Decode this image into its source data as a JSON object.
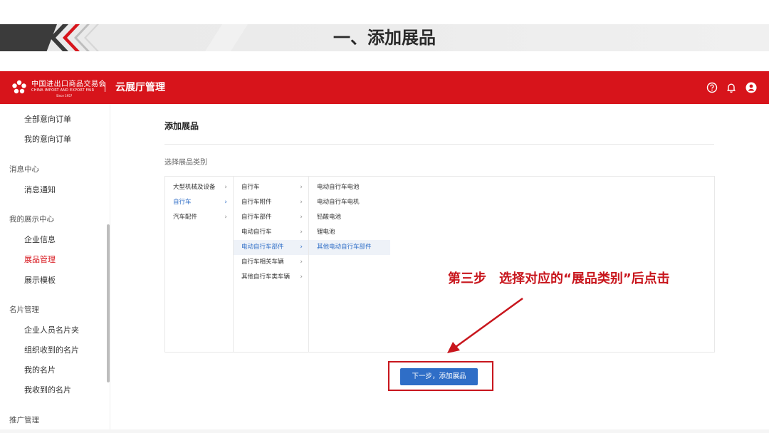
{
  "slide": {
    "title": "一、添加展品"
  },
  "header": {
    "logo_cn": "中国进出口商品交易会",
    "logo_en": "CHINA IMPORT AND EXPORT FAIR",
    "logo_since": "Since 1957",
    "app_title": "云展厅管理",
    "icons": [
      "help-icon",
      "bell-icon",
      "user-icon"
    ]
  },
  "sidebar": {
    "items": [
      {
        "label": "全部意向订单",
        "type": "item"
      },
      {
        "label": "我的意向订单",
        "type": "item"
      },
      {
        "label": "消息中心",
        "type": "group"
      },
      {
        "label": "消息通知",
        "type": "item"
      },
      {
        "label": "我的展示中心",
        "type": "group"
      },
      {
        "label": "企业信息",
        "type": "item"
      },
      {
        "label": "展品管理",
        "type": "item",
        "active": true
      },
      {
        "label": "展示模板",
        "type": "item"
      },
      {
        "label": "名片管理",
        "type": "group"
      },
      {
        "label": "企业人员名片夹",
        "type": "item"
      },
      {
        "label": "组织收到的名片",
        "type": "item"
      },
      {
        "label": "我的名片",
        "type": "item"
      },
      {
        "label": "我收到的名片",
        "type": "item"
      },
      {
        "label": "推广管理",
        "type": "group"
      }
    ]
  },
  "main": {
    "title": "添加展品",
    "category_label": "选择展品类别",
    "columns": [
      [
        "大型机械及设备",
        "自行车",
        "汽车配件"
      ],
      [
        "自行车",
        "自行车附件",
        "自行车部件",
        "电动自行车",
        "电动自行车部件",
        "自行车相关车辆",
        "其他自行车类车辆"
      ],
      [
        "电动自行车电池",
        "电动自行车电机",
        "铅酸电池",
        "锂电池",
        "其他电动自行车部件"
      ]
    ],
    "arrow_glyph": "›",
    "next_button": "下一步，添加展品"
  },
  "annotation": {
    "text": "第三步　选择对应的“展品类别”后点击",
    "color": "#c8161d"
  },
  "colors": {
    "brand_red": "#d7141b",
    "primary_blue": "#2f6ec7"
  }
}
